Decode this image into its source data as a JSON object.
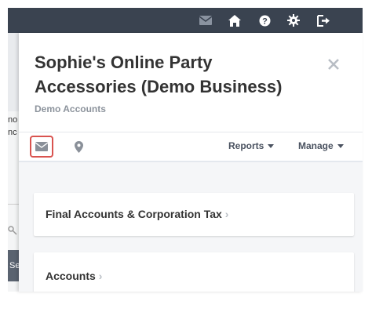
{
  "topbar": {
    "icons": [
      "mail-icon",
      "home-icon",
      "help-icon",
      "settings-icon",
      "logout-icon"
    ]
  },
  "background": {
    "text_fragments": [
      "no",
      "nc"
    ],
    "button_fragment": "Se"
  },
  "modal": {
    "title": "Sophie's Online Party Accessories (Demo Business)",
    "subtitle": "Demo Accounts",
    "close_symbol": "×"
  },
  "toolbar": {
    "mail_icon": "envelope-icon",
    "location_icon": "map-pin-icon",
    "reports_label": "Reports",
    "manage_label": "Manage"
  },
  "cards": [
    {
      "label": "Final Accounts & Corporation Tax"
    },
    {
      "label": "Accounts"
    }
  ],
  "colors": {
    "topbar": "#3a4350",
    "highlight": "#d9534f",
    "text": "#333333",
    "muted": "#8c939c"
  }
}
